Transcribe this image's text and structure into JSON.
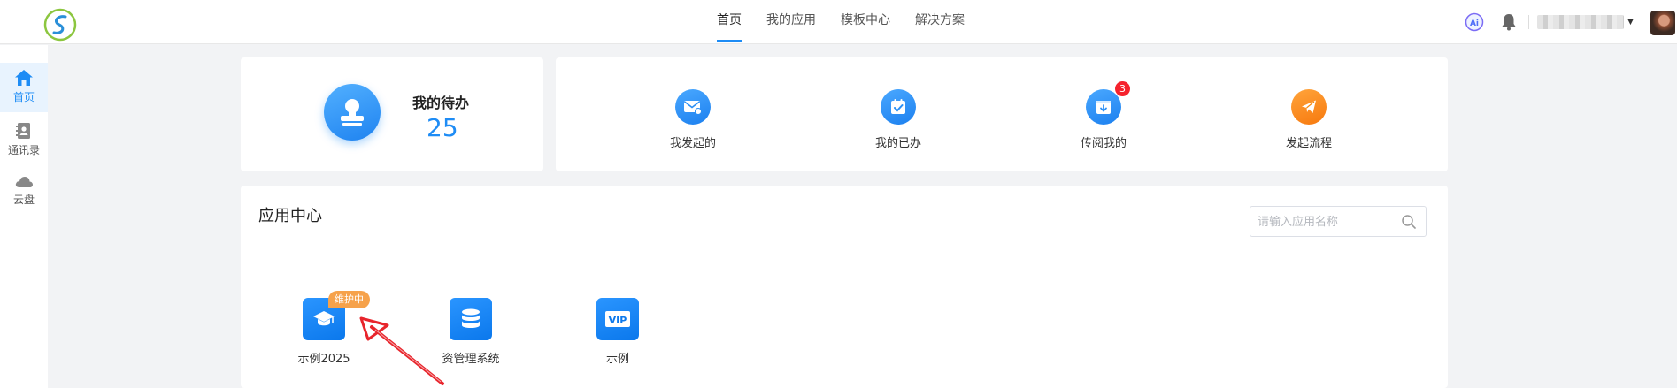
{
  "topbar": {
    "nav": [
      {
        "label": "首页",
        "active": true
      },
      {
        "label": "我的应用",
        "active": false
      },
      {
        "label": "模板中心",
        "active": false
      },
      {
        "label": "解决方案",
        "active": false
      }
    ],
    "ai_text": "Ai",
    "accent": "#1e8cf5"
  },
  "sidebar": {
    "items": [
      {
        "label": "首页",
        "icon": "home-icon",
        "active": true
      },
      {
        "label": "通讯录",
        "icon": "contacts-icon",
        "active": false
      },
      {
        "label": "云盘",
        "icon": "cloud-icon",
        "active": false
      }
    ]
  },
  "todo": {
    "title": "我的待办",
    "count": "25"
  },
  "quick": {
    "items": [
      {
        "label": "我发起的",
        "icon": "mail-icon"
      },
      {
        "label": "我的已办",
        "icon": "calendar-check-icon"
      },
      {
        "label": "传阅我的",
        "icon": "inbox-download-icon",
        "badge": "3"
      },
      {
        "label": "发起流程",
        "icon": "paper-plane-icon"
      }
    ]
  },
  "app_center": {
    "title": "应用中心",
    "search_placeholder": "请输入应用名称",
    "apps": [
      {
        "label": "示例2025",
        "icon": "graduation-cap-icon",
        "tag": "维护中"
      },
      {
        "label": "资管理系统",
        "icon": "database-icon"
      },
      {
        "label": "示例",
        "icon": "vip-icon",
        "icon_text": "VIP"
      }
    ]
  },
  "colors": {
    "primary": "#1e8cf5",
    "orange": "#f7790e",
    "badge_red": "#f5222d",
    "tag_orange": "#f6a24b",
    "arrow_red": "#e8252c"
  }
}
